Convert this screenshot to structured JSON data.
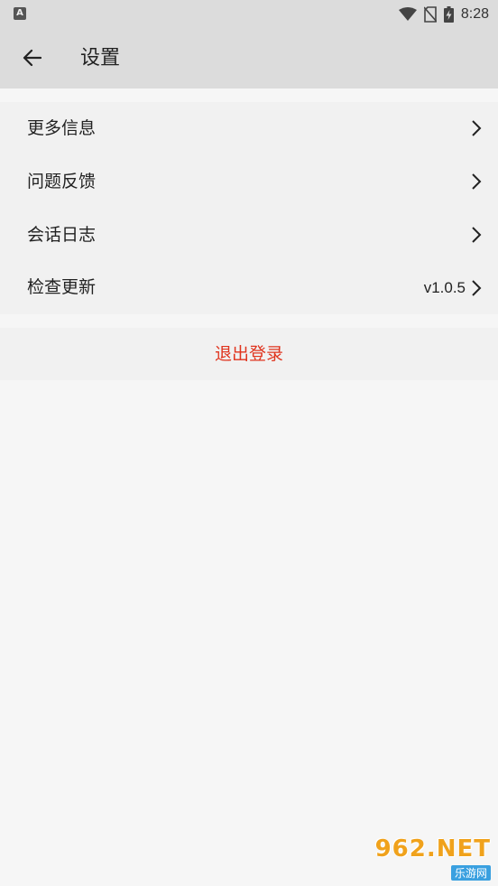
{
  "status_bar": {
    "time": "8:28",
    "left_icon_glyph": "A",
    "icons": [
      "wifi-icon",
      "no-sim-icon",
      "battery-charging-icon"
    ]
  },
  "app_bar": {
    "title": "设置",
    "back_icon": "arrow-left-icon"
  },
  "menu": {
    "items": [
      {
        "label": "更多信息",
        "value": ""
      },
      {
        "label": "问题反馈",
        "value": ""
      },
      {
        "label": "会话日志",
        "value": ""
      },
      {
        "label": "检查更新",
        "value": "v1.0.5"
      }
    ]
  },
  "logout": {
    "label": "退出登录",
    "color": "#e0341e"
  },
  "watermark": {
    "brand": "962.NET",
    "sub": "乐游网"
  },
  "colors": {
    "app_bar_bg": "#dcdcdc",
    "page_bg": "#f6f6f6",
    "group_bg": "#f1f1f1"
  }
}
